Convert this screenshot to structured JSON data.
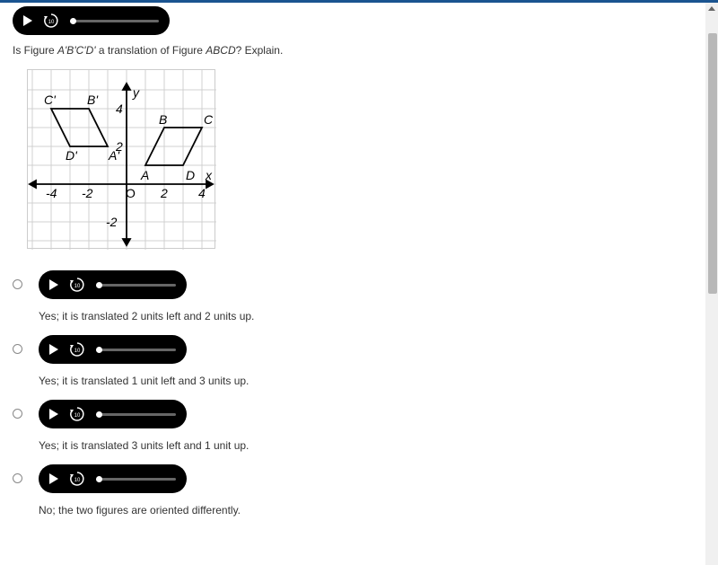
{
  "question": {
    "prefix": "Is Figure ",
    "fig1": "A'B'C'D'",
    "mid": " a translation of Figure ",
    "fig2": "ABCD",
    "suffix": "? Explain."
  },
  "options": [
    {
      "text": "Yes; it is translated 2 units left and 2 units up."
    },
    {
      "text": "Yes; it is translated 1 unit left and 3 units up."
    },
    {
      "text": "Yes; it is translated 3 units left and 1 unit up."
    },
    {
      "text": "No; the two figures are oriented differently."
    }
  ],
  "chart_data": {
    "type": "coordinate-grid",
    "xlim": [
      -5,
      5
    ],
    "ylim": [
      -3,
      5
    ],
    "x_ticks": [
      -4,
      -2,
      2,
      4
    ],
    "y_ticks": [
      -2,
      2,
      4
    ],
    "origin_label": "O",
    "x_axis_label": "x",
    "y_axis_label": "y",
    "figures": [
      {
        "name": "ABCD",
        "vertices": [
          {
            "label": "A",
            "x": 1,
            "y": 1
          },
          {
            "label": "B",
            "x": 2,
            "y": 3
          },
          {
            "label": "C",
            "x": 4,
            "y": 3
          },
          {
            "label": "D",
            "x": 3,
            "y": 1
          }
        ]
      },
      {
        "name": "A'B'C'D'",
        "vertices": [
          {
            "label": "A'",
            "x": -1,
            "y": 2
          },
          {
            "label": "B'",
            "x": -2,
            "y": 4
          },
          {
            "label": "C'",
            "x": -4,
            "y": 4
          },
          {
            "label": "D'",
            "x": -3,
            "y": 2
          }
        ]
      }
    ]
  },
  "audio": {
    "rewind_seconds": "10"
  }
}
